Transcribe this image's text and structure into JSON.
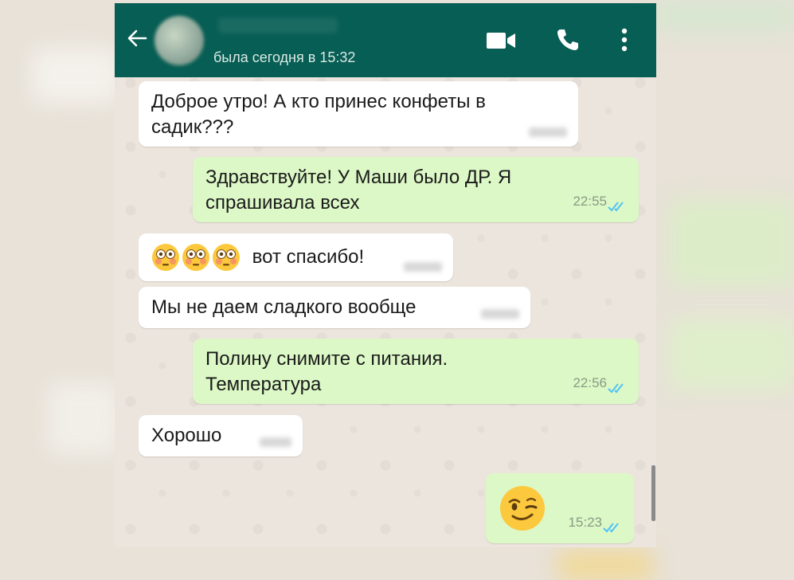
{
  "header": {
    "last_seen": "была сегодня в 15:32",
    "icons": [
      "back-arrow-icon",
      "video-call-icon",
      "voice-call-icon",
      "more-vert-icon"
    ],
    "colors": {
      "bar": "#075e54",
      "incoming": "#ffffff",
      "outgoing": "#dcf8c6",
      "tick": "#4fc3f7"
    }
  },
  "messages": [
    {
      "dir": "in",
      "text": "Доброе утро! А кто принес конфеты в садик???"
    },
    {
      "dir": "out",
      "text": "Здравствуйте! У Маши было ДР. Я спрашивала всех",
      "time": "22:55",
      "status": "read"
    },
    {
      "dir": "in",
      "emoji": [
        "flushed-face",
        "flushed-face",
        "flushed-face"
      ],
      "text": "вот спасибо!"
    },
    {
      "dir": "in",
      "text": "Мы не даем сладкого вообще"
    },
    {
      "dir": "out",
      "text": "Полину снимите с питания. Температура",
      "time": "22:56",
      "status": "read"
    },
    {
      "dir": "in",
      "text": "Хорошо"
    },
    {
      "dir": "out",
      "emoji": [
        "winking-face"
      ],
      "time": "15:23",
      "status": "read"
    }
  ]
}
